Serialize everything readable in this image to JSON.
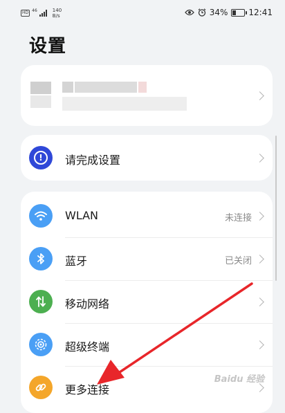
{
  "status_bar": {
    "hd_badge": "HD",
    "signal_label": "46",
    "net_speed_value": "140",
    "net_speed_unit": "B/s",
    "battery_percent": "34%",
    "battery_level": 0.34,
    "time": "12:41",
    "icons": [
      "eye-comfort-icon",
      "alarm-icon",
      "battery-icon"
    ]
  },
  "header": {
    "title": "设置"
  },
  "account": {
    "chevron": "chevron-right-icon"
  },
  "setup": {
    "label": "请完成设置",
    "icon": "info-circle-icon",
    "color": "#2f48d8"
  },
  "connections": [
    {
      "label": "WLAN",
      "status": "未连接",
      "icon": "wifi-icon",
      "color": "#4a9ff5"
    },
    {
      "label": "蓝牙",
      "status": "已关闭",
      "icon": "bluetooth-icon",
      "color": "#4a9ff5"
    },
    {
      "label": "移动网络",
      "status": "",
      "icon": "mobile-data-icon",
      "color": "#4caf50"
    },
    {
      "label": "超级终端",
      "status": "",
      "icon": "super-device-icon",
      "color": "#4a9ff5"
    },
    {
      "label": "更多连接",
      "status": "",
      "icon": "link-icon",
      "color": "#f4a62a"
    }
  ],
  "annotation": {
    "color": "#e8262a"
  },
  "watermark": "Baidu 经验"
}
